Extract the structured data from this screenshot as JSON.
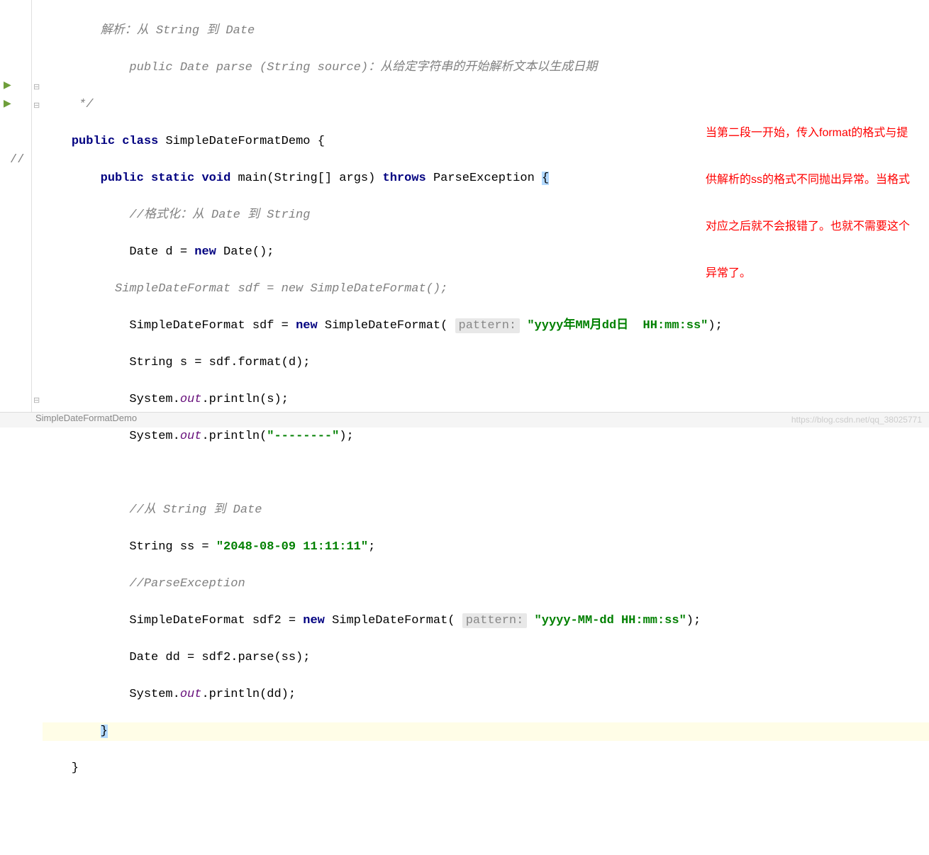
{
  "code": {
    "comment1": "        解析：从 String 到 Date",
    "comment2": "            public Date parse (String source)：从给定字符串的开始解析文本以生成日期",
    "comment3": "     */",
    "line_class": {
      "kw1": "public",
      "kw2": "class",
      "name": "SimpleDateFormatDemo {"
    },
    "line_main": {
      "kw1": "public",
      "kw2": "static",
      "kw3": "void",
      "text1": "main(String[] args) ",
      "kw4": "throws",
      "text2": "ParseException ",
      "brace": "{"
    },
    "comment4": "            //格式化：从 Date 到 String",
    "line_date": {
      "text1": "            Date d = ",
      "kw": "new",
      "text2": " Date();"
    },
    "comment_marker": "//",
    "comment5": "          SimpleDateFormat sdf = new SimpleDateFormat();",
    "line_sdf": {
      "text1": "            SimpleDateFormat sdf = ",
      "kw": "new",
      "text2": " SimpleDateFormat( ",
      "hint": "pattern:",
      "str": "\"yyyy年MM月dd日  HH:mm:ss\"",
      "text3": ");"
    },
    "line_str": "            String s = sdf.format(d);",
    "line_out1": {
      "text1": "            System.",
      "field": "out",
      "text2": ".println(s);"
    },
    "line_out2": {
      "text1": "            System.",
      "field": "out",
      "text2": ".println(",
      "str": "\"--------\"",
      "text3": ");"
    },
    "comment6": "            //从 String 到 Date",
    "line_ss": {
      "text1": "            String ss = ",
      "str": "\"2048-08-09 11:11:11\"",
      "text2": ";"
    },
    "comment7": "            //ParseException",
    "line_sdf2": {
      "text1": "            SimpleDateFormat sdf2 = ",
      "kw": "new",
      "text2": " SimpleDateFormat( ",
      "hint": "pattern:",
      "str": "\"yyyy-MM-dd HH:mm:ss\"",
      "text3": ");"
    },
    "line_dd": "            Date dd = sdf2.parse(ss);",
    "line_out3": {
      "text1": "            System.",
      "field": "out",
      "text2": ".println(dd);"
    },
    "line_close1": "        ",
    "brace_close1": "}",
    "line_close2": "    }"
  },
  "annotation": {
    "line1": "当第二段一开始，传入format的格式与提",
    "line2": "供解析的ss的格式不同抛出异常。当格式",
    "line3": "对应之后就不会报错了。也就不需要这个",
    "line4": "异常了。"
  },
  "tab": "SimpleDateFormatDemo",
  "watermark": "https://blog.csdn.net/qq_38025771"
}
